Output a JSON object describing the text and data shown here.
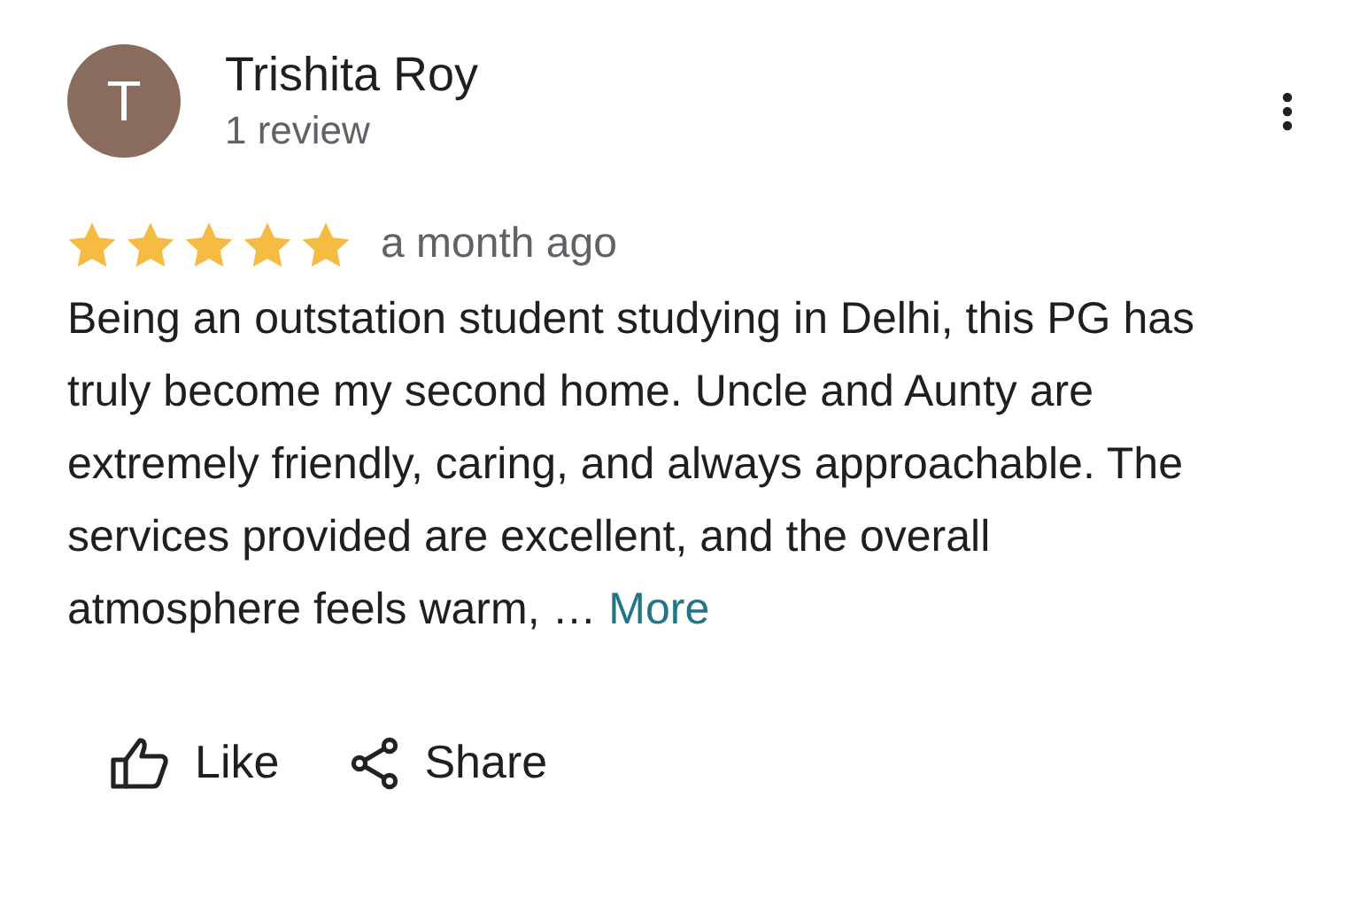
{
  "reviewer": {
    "initial": "T",
    "name": "Trishita Roy",
    "review_count": "1 review"
  },
  "stars": 5,
  "time": "a month ago",
  "text": "Being an outstation student studying in Delhi, this PG has truly become my second home. Uncle and Aunty are extremely friendly, caring, and always approachable. The services provided are excellent, and the overall atmosphere feels warm, …",
  "more_link": "More",
  "actions": [
    {
      "kind": "like",
      "label": "Like"
    },
    {
      "kind": "share",
      "label": "Share"
    }
  ]
}
